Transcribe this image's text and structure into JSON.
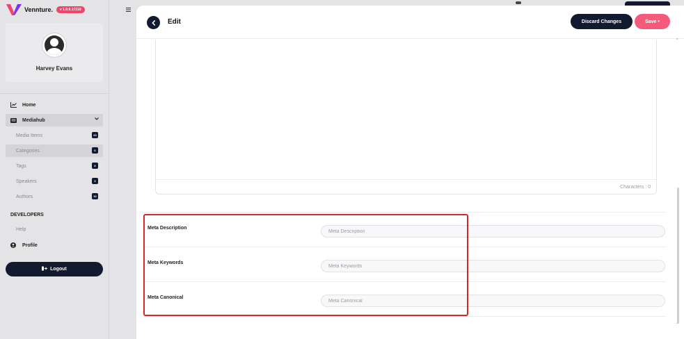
{
  "brand": {
    "name": "Vennture.",
    "version": "v 1.0.0.17218",
    "logo_colors": [
      "#f2436b",
      "#7b2ff7"
    ]
  },
  "user": {
    "name": "Harvey Evans"
  },
  "nav": {
    "home": "Home",
    "mediahub": "Mediahub",
    "sub_items": [
      {
        "label": "Media Items",
        "count": "23"
      },
      {
        "label": "Categories",
        "count": "6"
      },
      {
        "label": "Tags",
        "count": "8"
      },
      {
        "label": "Speakers",
        "count": "3"
      },
      {
        "label": "Authors",
        "count": "16"
      }
    ],
    "developers": "DEVELOPERS",
    "help": "Help",
    "profile": "Profile",
    "logout": "Logout"
  },
  "header": {
    "title": "Edit",
    "discard": "Discard Changes",
    "save": "Save"
  },
  "editor": {
    "characters_label": "Characters : 0"
  },
  "meta": {
    "description": {
      "label": "Meta Description",
      "placeholder": "Meta Description",
      "value": ""
    },
    "keywords": {
      "label": "Meta Keywords",
      "placeholder": "Meta Keywords",
      "value": ""
    },
    "canonical": {
      "label": "Meta Canonical",
      "placeholder": "Meta Canonical",
      "value": ""
    }
  },
  "colors": {
    "navy": "#121a2f",
    "accent": "#f65a7b",
    "highlight": "#d7262c"
  }
}
